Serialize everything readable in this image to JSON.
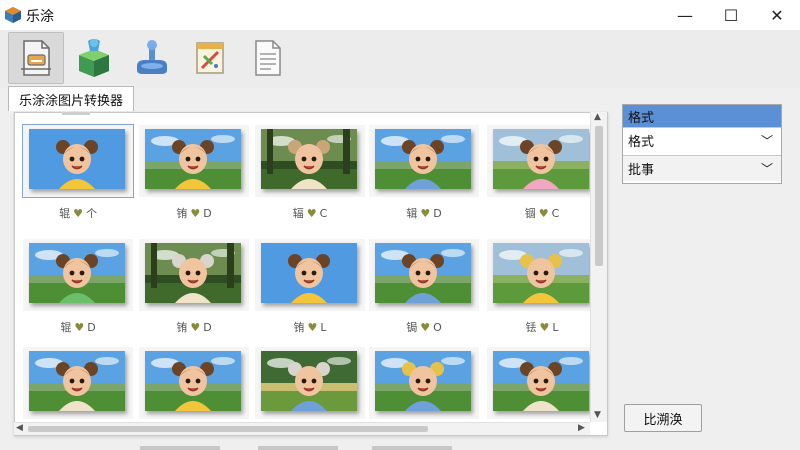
{
  "app": {
    "title": "乐涂"
  },
  "window_controls": {
    "minimize": "—",
    "maximize": "☐",
    "close": "✕"
  },
  "toolbar": {
    "tools": [
      {
        "icon": "document-convert-icon"
      },
      {
        "icon": "puzzle-box-icon"
      },
      {
        "icon": "joystick-icon"
      },
      {
        "icon": "pencil-pad-icon"
      },
      {
        "icon": "document-icon"
      }
    ]
  },
  "tab": {
    "label": "乐涂涂图片转换器"
  },
  "gallery": {
    "items": [
      {
        "label_a": "辊",
        "label_b": "个",
        "scene": "sky",
        "hair": "brown",
        "shirt": "yellow"
      },
      {
        "label_a": "铕",
        "label_b": "D",
        "scene": "field",
        "hair": "brown",
        "shirt": "yellow"
      },
      {
        "label_a": "辐",
        "label_b": "C",
        "scene": "forest",
        "hair": "light",
        "shirt": "cream"
      },
      {
        "label_a": "辑",
        "label_b": "D",
        "scene": "field",
        "hair": "brown",
        "shirt": "blue"
      },
      {
        "label_a": "锢",
        "label_b": "C",
        "scene": "meadow",
        "hair": "brown",
        "shirt": "pink"
      },
      {
        "label_a": "辊",
        "label_b": "D",
        "scene": "field",
        "hair": "brown",
        "shirt": "green"
      },
      {
        "label_a": "铕",
        "label_b": "D",
        "scene": "forest",
        "hair": "white",
        "shirt": "cream"
      },
      {
        "label_a": "铕",
        "label_b": "L",
        "scene": "sky",
        "hair": "brown",
        "shirt": "yellow"
      },
      {
        "label_a": "锔",
        "label_b": "O",
        "scene": "field",
        "hair": "brown",
        "shirt": "blue"
      },
      {
        "label_a": "铥",
        "label_b": "L",
        "scene": "meadow",
        "hair": "yellow",
        "shirt": "yellow"
      },
      {
        "label_a": "",
        "label_b": "",
        "scene": "field",
        "hair": "brown",
        "shirt": "cream"
      },
      {
        "label_a": "",
        "label_b": "",
        "scene": "field",
        "hair": "brown",
        "shirt": "yellow"
      },
      {
        "label_a": "",
        "label_b": "",
        "scene": "flowers",
        "hair": "white",
        "shirt": "blue"
      },
      {
        "label_a": "",
        "label_b": "",
        "scene": "field",
        "hair": "yellow",
        "shirt": "blue"
      },
      {
        "label_a": "",
        "label_b": "",
        "scene": "field",
        "hair": "brown",
        "shirt": "cream"
      }
    ]
  },
  "format_panel": {
    "header": "格式",
    "format_select": {
      "value": "格式"
    },
    "batch_select": {
      "value": "批事"
    }
  },
  "action_button": {
    "label": "比溯涣"
  },
  "colors": {
    "accent": "#5b8fd6",
    "window_bg": "#efefef"
  }
}
